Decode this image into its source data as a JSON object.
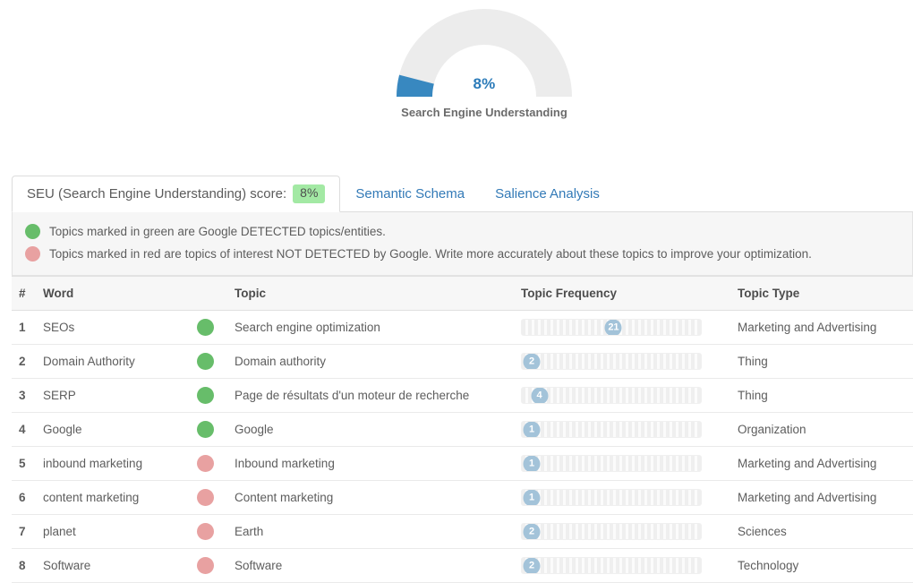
{
  "gauge": {
    "value_label": "8%",
    "percent": 8,
    "caption": "Search Engine Understanding",
    "fill_color": "#3888c0",
    "track_color": "#ececec",
    "value_color": "#2b7bb9"
  },
  "tabs": [
    {
      "id": "seu-score",
      "label": "SEU (Search Engine Understanding) score:",
      "badge": "8%",
      "active": true
    },
    {
      "id": "semantic-schema",
      "label": "Semantic Schema",
      "badge": null,
      "active": false
    },
    {
      "id": "salience-analysis",
      "label": "Salience Analysis",
      "badge": null,
      "active": false
    }
  ],
  "legend": [
    {
      "color": "green",
      "text": "Topics marked in green are Google DETECTED topics/entities."
    },
    {
      "color": "red",
      "text": "Topics marked in red are topics of interest NOT DETECTED by Google. Write more accurately about these topics to improve your optimization."
    }
  ],
  "table": {
    "columns": [
      "#",
      "Word",
      "",
      "Topic",
      "Topic Frequency",
      "Topic Type"
    ],
    "rows": [
      {
        "num": "1",
        "word": "SEOs",
        "status": "green",
        "topic": "Search engine optimization",
        "frequency": 21,
        "frequency_label": "21",
        "type": "Marketing and Advertising"
      },
      {
        "num": "2",
        "word": "Domain Authority",
        "status": "green",
        "topic": "Domain authority",
        "frequency": 2,
        "frequency_label": "2",
        "type": "Thing"
      },
      {
        "num": "3",
        "word": "SERP",
        "status": "green",
        "topic": "Page de résultats d'un moteur de recherche",
        "frequency": 4,
        "frequency_label": "4",
        "type": "Thing"
      },
      {
        "num": "4",
        "word": "Google",
        "status": "green",
        "topic": "Google",
        "frequency": 1,
        "frequency_label": "1",
        "type": "Organization"
      },
      {
        "num": "5",
        "word": "inbound marketing",
        "status": "red",
        "topic": "Inbound marketing",
        "frequency": 1,
        "frequency_label": "1",
        "type": "Marketing and Advertising"
      },
      {
        "num": "6",
        "word": "content marketing",
        "status": "red",
        "topic": "Content marketing",
        "frequency": 1,
        "frequency_label": "1",
        "type": "Marketing and Advertising"
      },
      {
        "num": "7",
        "word": "planet",
        "status": "red",
        "topic": "Earth",
        "frequency": 2,
        "frequency_label": "2",
        "type": "Sciences"
      },
      {
        "num": "8",
        "word": "Software",
        "status": "red",
        "topic": "Software",
        "frequency": 2,
        "frequency_label": "2",
        "type": "Technology"
      }
    ],
    "frequency_max": 41
  },
  "colors": {
    "green_dot": "#67bd6a",
    "red_dot": "#e8a1a1",
    "badge_green": "#a3e9a4",
    "link_blue": "#337ab7",
    "freq_badge": "#a3c3d9"
  }
}
